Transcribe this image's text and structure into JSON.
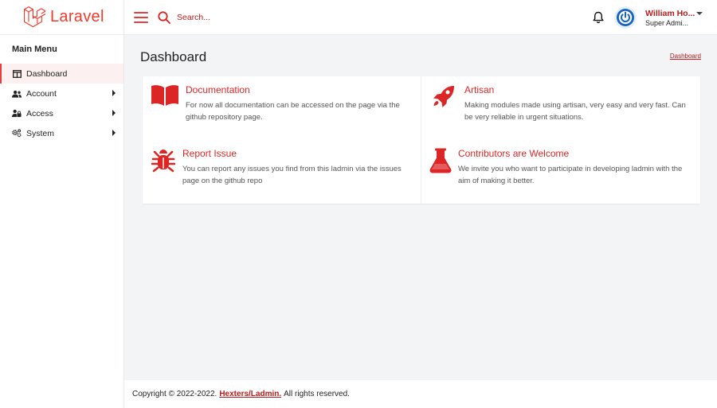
{
  "brand": {
    "name": "Laravel"
  },
  "header": {
    "search_placeholder": "Search...",
    "user_name": "William Ho...",
    "user_role": "Super Admi..."
  },
  "sidebar": {
    "title": "Main Menu",
    "items": [
      {
        "label": "Dashboard",
        "icon": "table-columns-icon",
        "active": true
      },
      {
        "label": "Account",
        "icon": "users-icon",
        "has_submenu": true
      },
      {
        "label": "Access",
        "icon": "user-lock-icon",
        "has_submenu": true
      },
      {
        "label": "System",
        "icon": "gears-icon",
        "has_submenu": true
      }
    ]
  },
  "main": {
    "title": "Dashboard",
    "breadcrumb": "Dashboard",
    "features": [
      {
        "title": "Documentation",
        "text": "For now all documentation can be accessed on the page via the github repository page.",
        "icon": "book-open-icon"
      },
      {
        "title": "Artisan",
        "text": "Making modules made using artisan, very easy and very fast. Can be very reliable in urgent situations.",
        "icon": "rocket-icon"
      },
      {
        "title": "Report Issue",
        "text": "You can report any issues you find from this ladmin via the issues page on the github repo",
        "icon": "bug-icon"
      },
      {
        "title": "Contributors are Welcome",
        "text": "We invite you who want to participate in developing ladmin with the aim of making it better.",
        "icon": "flask-icon"
      }
    ]
  },
  "footer": {
    "prefix": "Copyright © 2022-2022.",
    "link": "Hexters/Ladmin.",
    "suffix": "All rights reserved."
  },
  "colors": {
    "accent": "#e53e3e",
    "brand": "#ef3b2d",
    "link": "#b91c1c"
  }
}
